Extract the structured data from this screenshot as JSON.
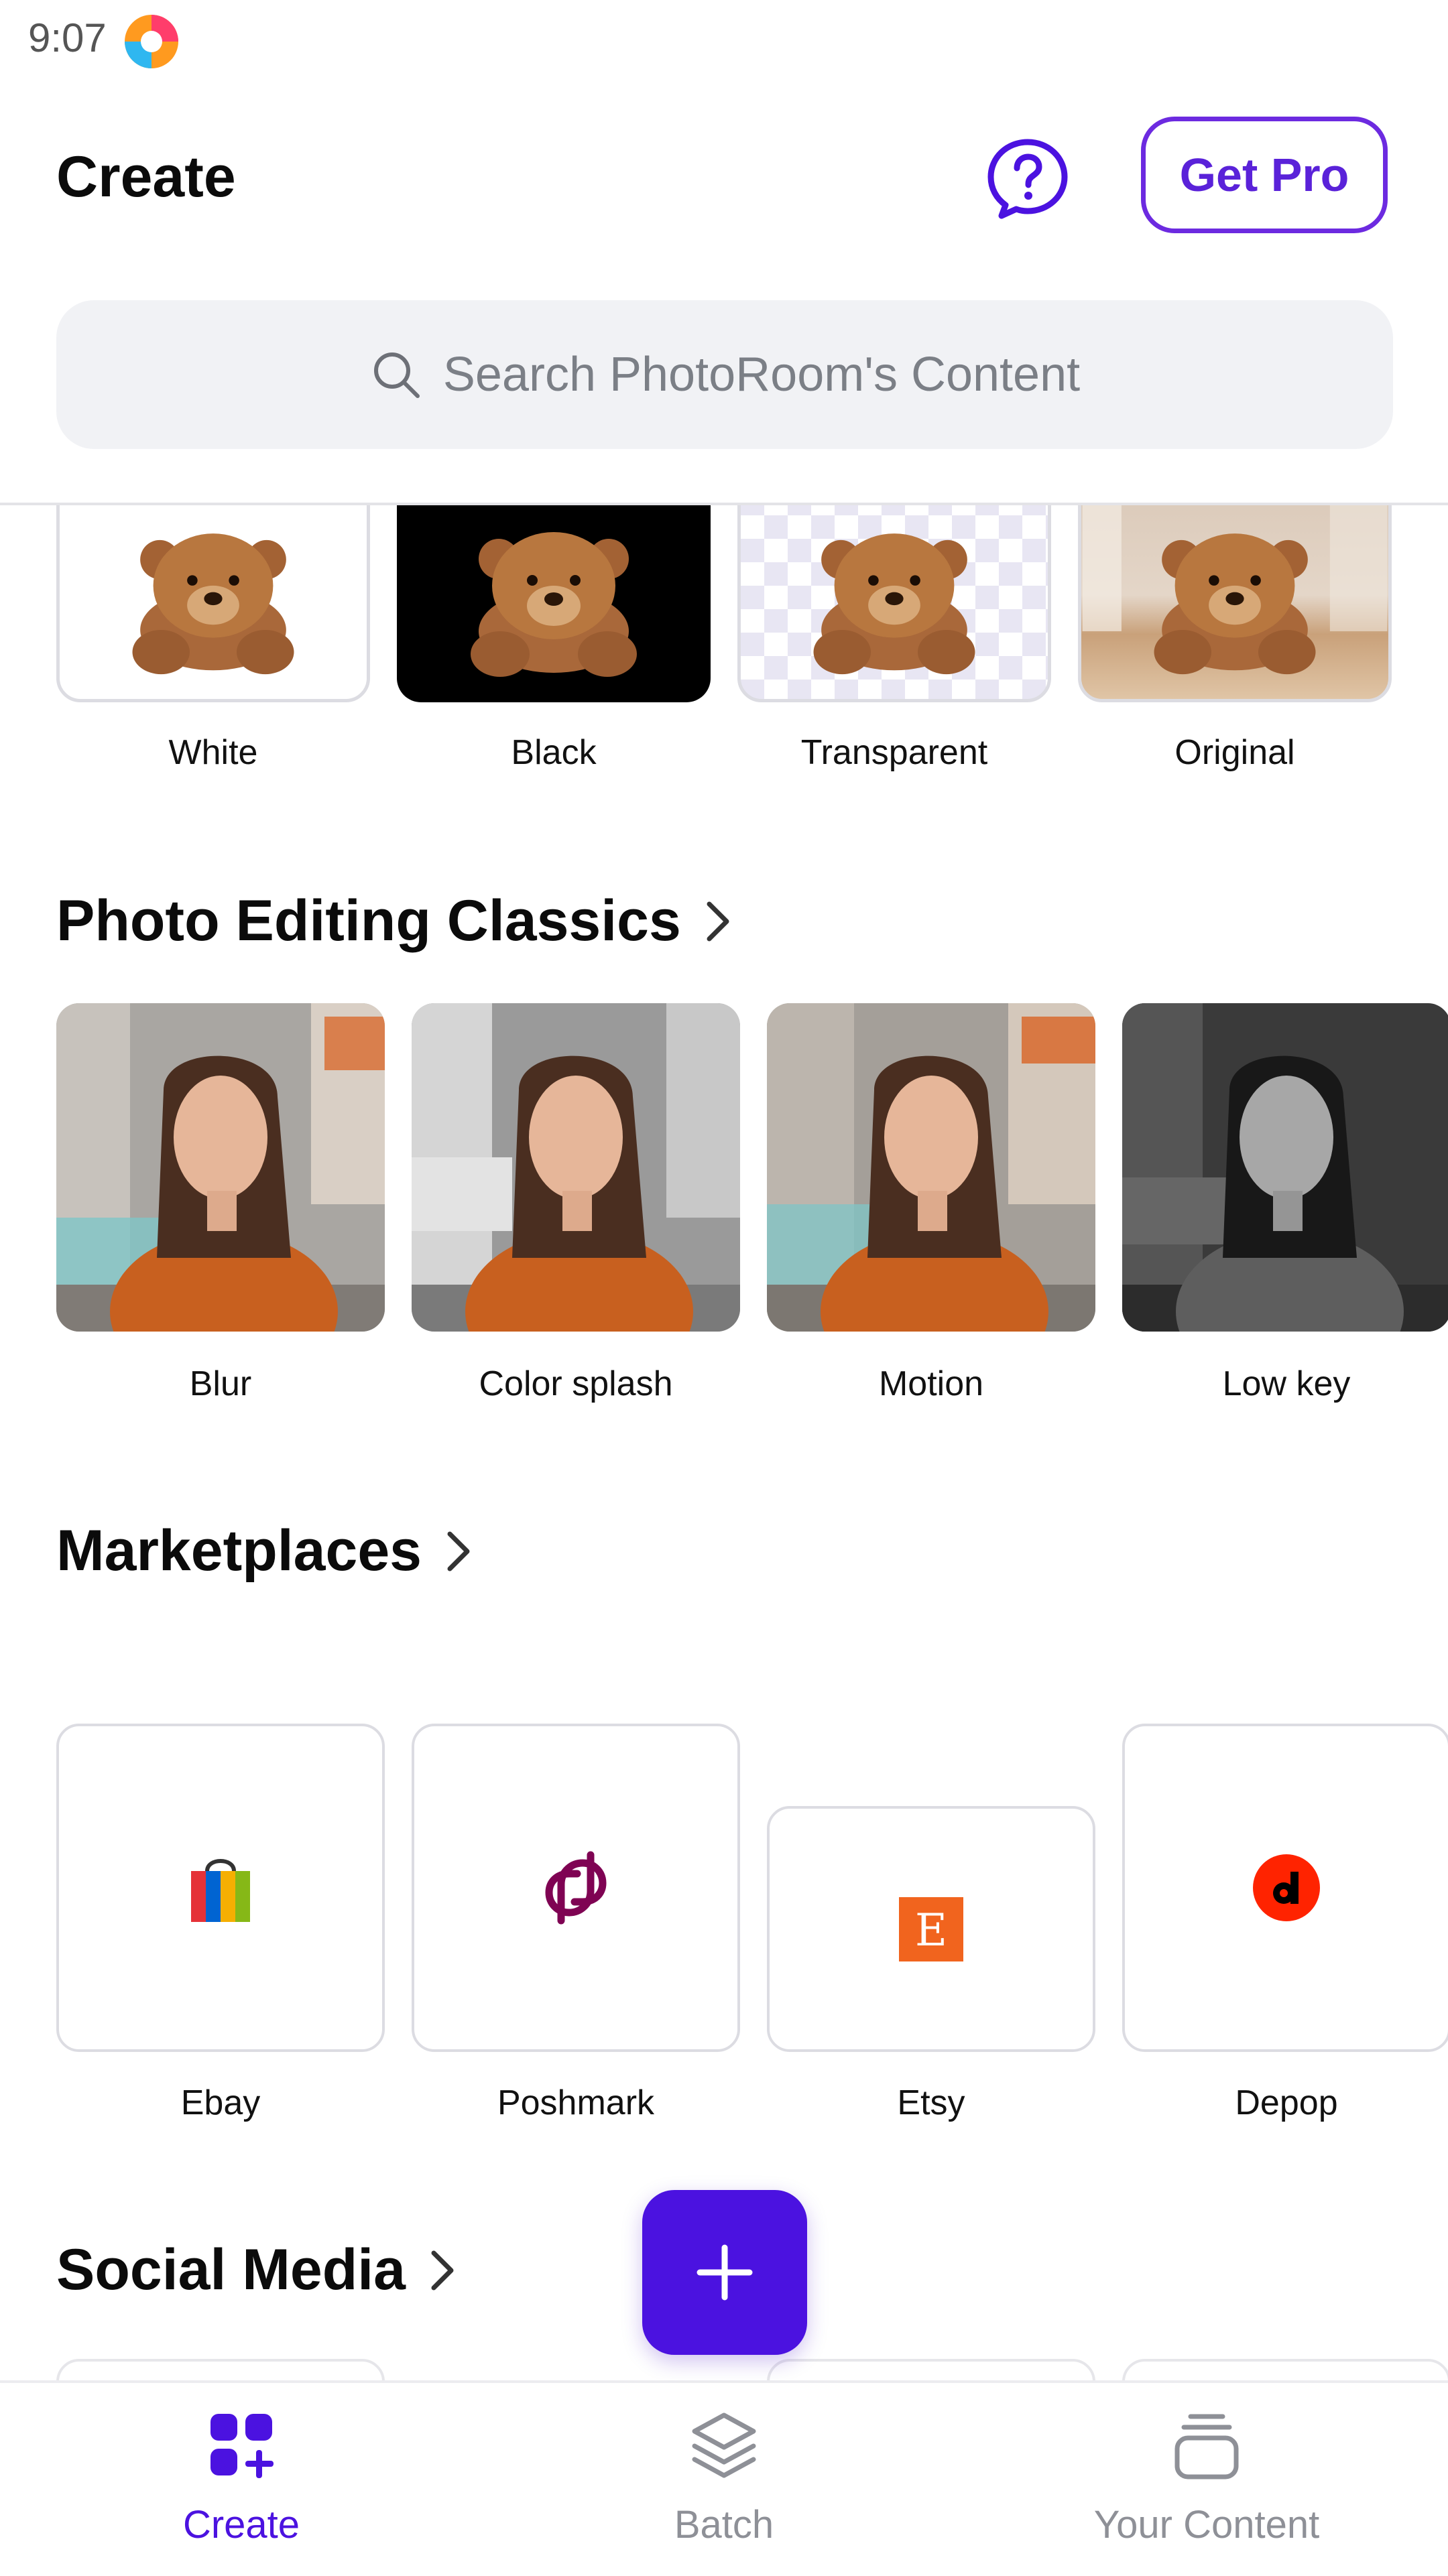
{
  "status_bar": {
    "time": "9:07",
    "app_icon": "photoroom-logo-icon"
  },
  "header": {
    "title": "Create",
    "help_icon": "help-icon",
    "get_pro_label": "Get Pro"
  },
  "search": {
    "placeholder": "Search PhotoRoom's Content",
    "icon": "search-icon"
  },
  "backgrounds": {
    "items": [
      {
        "label": "White"
      },
      {
        "label": "Black"
      },
      {
        "label": "Transparent"
      },
      {
        "label": "Original"
      }
    ]
  },
  "sections": {
    "photo_editing": {
      "title": "Photo Editing Classics",
      "items": [
        {
          "label": "Blur"
        },
        {
          "label": "Color splash"
        },
        {
          "label": "Motion"
        },
        {
          "label": "Low key"
        }
      ]
    },
    "marketplaces": {
      "title": "Marketplaces",
      "items": [
        {
          "label": "Ebay",
          "icon": "ebay-bag-icon"
        },
        {
          "label": "Poshmark",
          "icon": "poshmark-icon"
        },
        {
          "label": "Etsy",
          "icon": "etsy-icon"
        },
        {
          "label": "Depop",
          "icon": "depop-icon"
        }
      ]
    },
    "social_media": {
      "title": "Social Media"
    }
  },
  "fab": {
    "icon": "plus-icon"
  },
  "bottom_nav": {
    "items": [
      {
        "label": "Create",
        "icon": "create-grid-icon",
        "active": true
      },
      {
        "label": "Batch",
        "icon": "layers-icon",
        "active": false
      },
      {
        "label": "Your Content",
        "icon": "stack-icon",
        "active": false
      }
    ]
  },
  "colors": {
    "accent": "#4b12e0",
    "get_pro_border": "#6c2ae0",
    "etsy": "#f1641e",
    "depop": "#ff2300"
  }
}
